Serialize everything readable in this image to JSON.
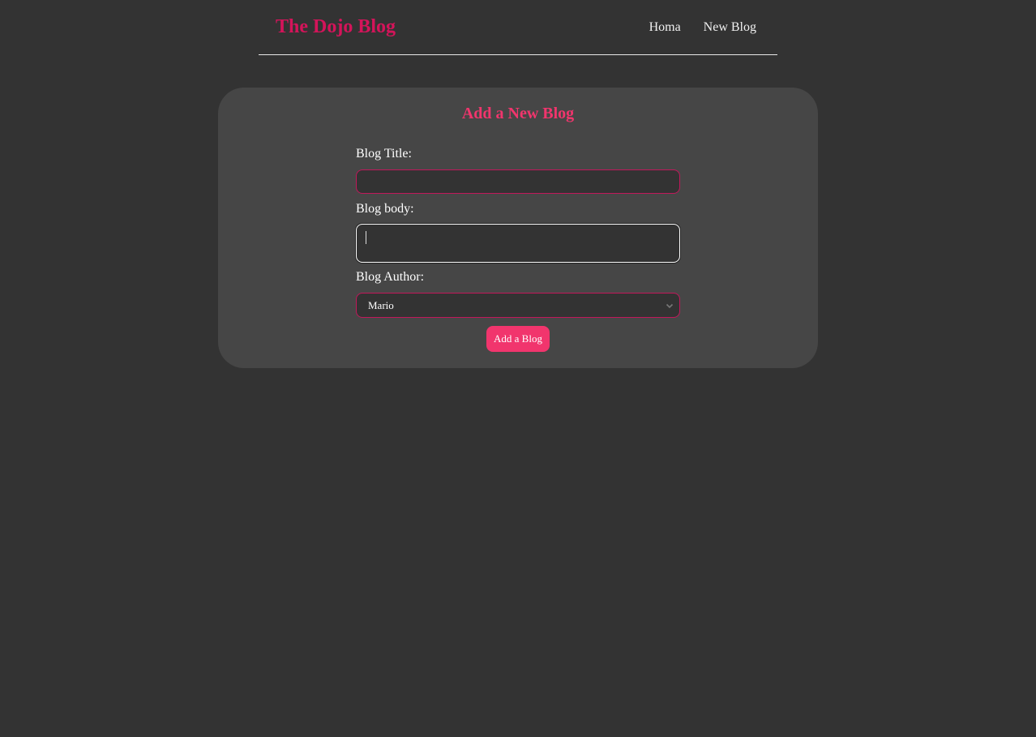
{
  "nav": {
    "brand": "The Dojo Blog",
    "links": [
      {
        "label": "Homa"
      },
      {
        "label": "New Blog"
      }
    ]
  },
  "form": {
    "heading": "Add a New Blog",
    "title_label": "Blog Title:",
    "title_value": "",
    "body_label": "Blog body:",
    "body_value": "",
    "author_label": "Blog Author:",
    "author_selected": "Mario",
    "submit_label": "Add a Blog"
  },
  "colors": {
    "background": "#333333",
    "card": "#464646",
    "brand": "#d4145a",
    "accent": "#f1356d",
    "field_border": "#c2185b"
  },
  "icons": {
    "select_arrow": "chevron-down-icon"
  }
}
